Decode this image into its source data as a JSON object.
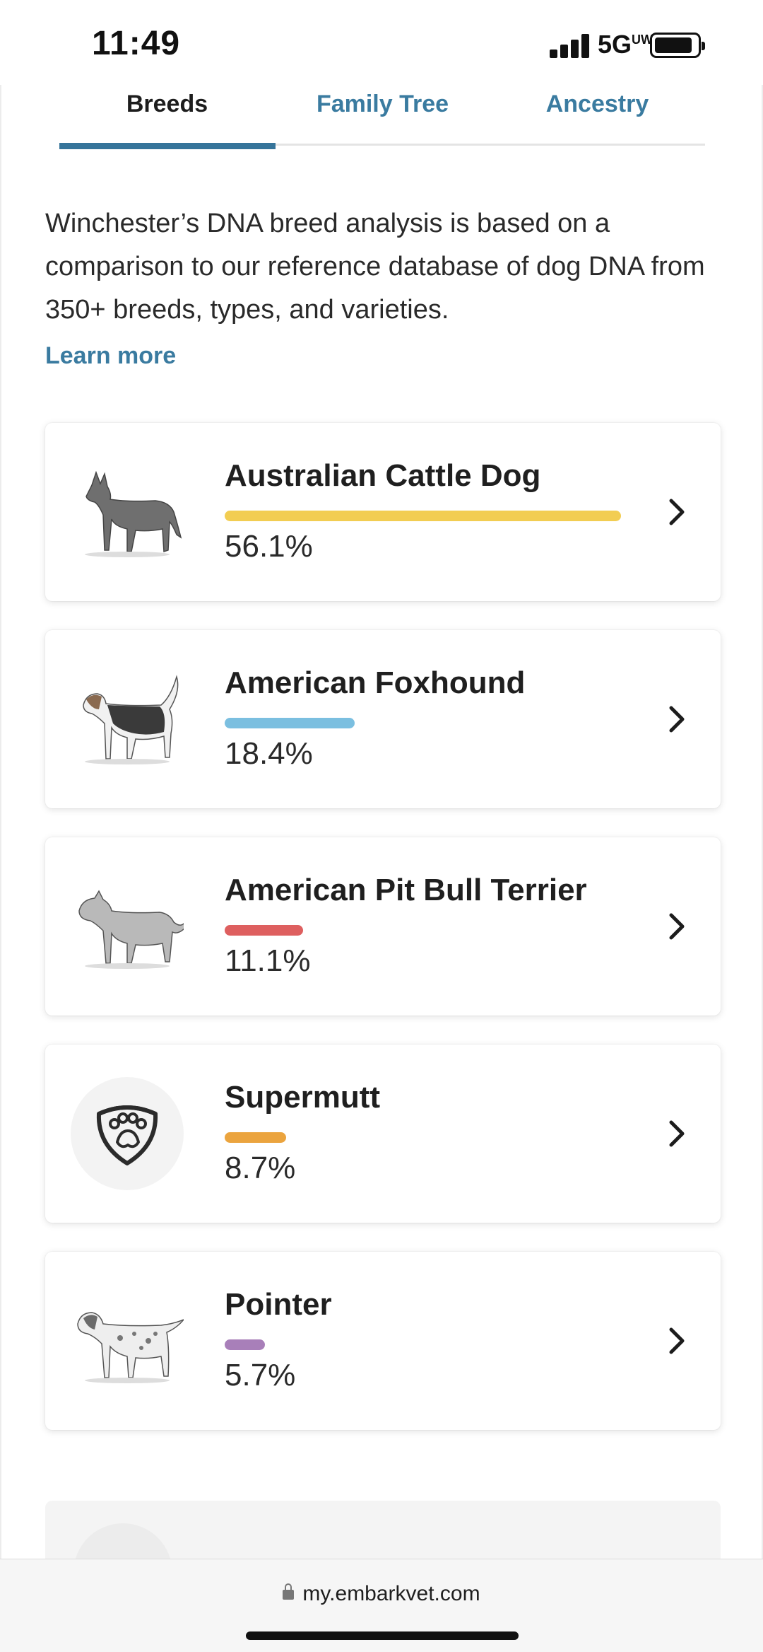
{
  "status_bar": {
    "time": "11:49",
    "network": "5G",
    "network_suffix": "UW"
  },
  "tabs": [
    {
      "label": "Breeds",
      "active": true
    },
    {
      "label": "Family Tree",
      "active": false
    },
    {
      "label": "Ancestry",
      "active": false
    }
  ],
  "intro": {
    "text": "Winchester’s DNA breed analysis is based on a comparison to our reference database of dog DNA from 350+ breeds, types, and varieties.",
    "link": "Learn more"
  },
  "breeds": [
    {
      "name": "Australian Cattle Dog",
      "percent": "56.1%",
      "fraction": 0.561,
      "color": "#f2cd52",
      "icon": "australian-cattle-dog-illustration"
    },
    {
      "name": "American Foxhound",
      "percent": "18.4%",
      "fraction": 0.184,
      "color": "#7bbfe0",
      "icon": "american-foxhound-illustration"
    },
    {
      "name": "American Pit Bull Terrier",
      "percent": "11.1%",
      "fraction": 0.111,
      "color": "#de5f5f",
      "icon": "american-pit-bull-terrier-illustration"
    },
    {
      "name": "Supermutt",
      "percent": "8.7%",
      "fraction": 0.087,
      "color": "#eba43e",
      "icon": "paw-shield-icon"
    },
    {
      "name": "Pointer",
      "percent": "5.7%",
      "fraction": 0.057,
      "color": "#a87fb9",
      "icon": "pointer-illustration"
    }
  ],
  "browser": {
    "url": "my.embarkvet.com"
  }
}
